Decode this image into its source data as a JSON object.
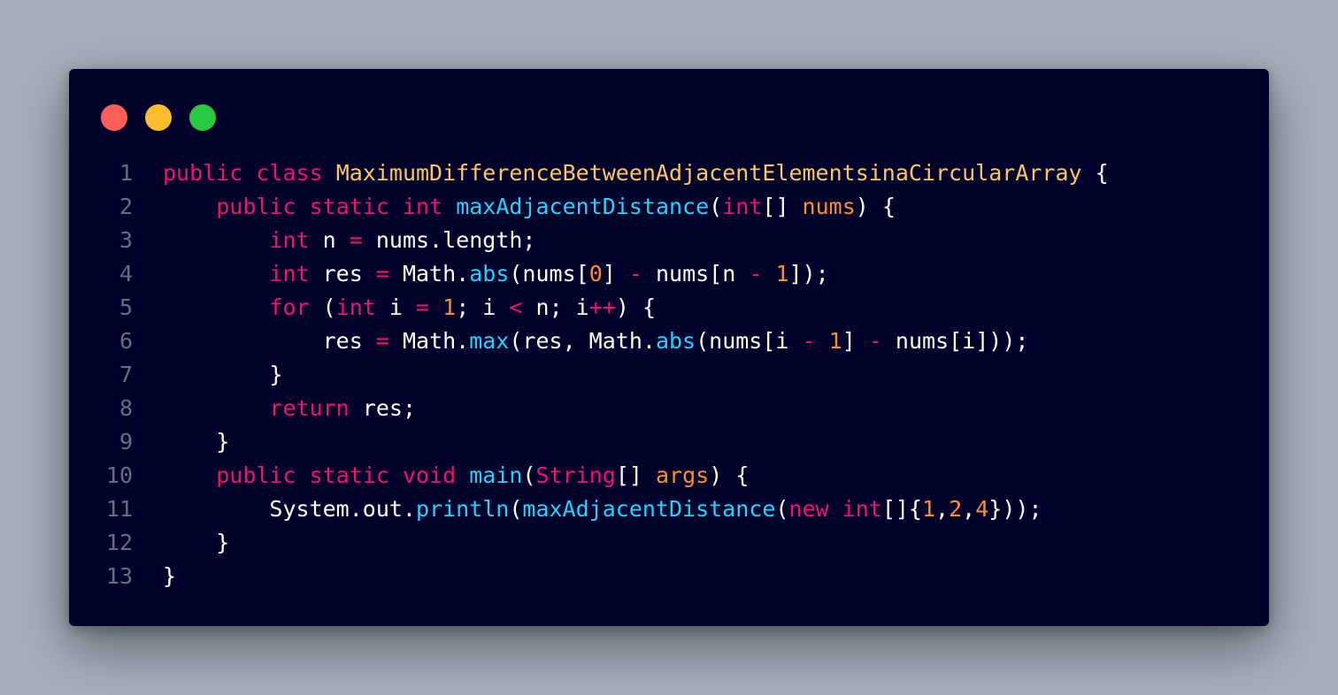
{
  "window": {
    "controls": [
      {
        "name": "close",
        "color": "#ff5f57"
      },
      {
        "name": "minimize",
        "color": "#febc2e"
      },
      {
        "name": "zoom",
        "color": "#28c840"
      }
    ]
  },
  "colors": {
    "kw": "#f0126b",
    "cls": "#ffc563",
    "fn": "#21d4fd",
    "num": "#ff8c2e",
    "prm": "#ff8c2e",
    "op": "#f0126b",
    "txt": "#ffffff"
  },
  "code_lines": [
    {
      "number": "1",
      "tokens": [
        {
          "t": "kw",
          "v": "public"
        },
        {
          "t": "txt",
          "v": " "
        },
        {
          "t": "kw",
          "v": "class"
        },
        {
          "t": "txt",
          "v": " "
        },
        {
          "t": "cls",
          "v": "MaximumDifferenceBetweenAdjacentElementsinaCircularArray"
        },
        {
          "t": "txt",
          "v": " {"
        }
      ]
    },
    {
      "number": "2",
      "tokens": [
        {
          "t": "txt",
          "v": "    "
        },
        {
          "t": "kw",
          "v": "public"
        },
        {
          "t": "txt",
          "v": " "
        },
        {
          "t": "kw",
          "v": "static"
        },
        {
          "t": "txt",
          "v": " "
        },
        {
          "t": "kw",
          "v": "int"
        },
        {
          "t": "txt",
          "v": " "
        },
        {
          "t": "fn",
          "v": "maxAdjacentDistance"
        },
        {
          "t": "txt",
          "v": "("
        },
        {
          "t": "kw",
          "v": "int"
        },
        {
          "t": "txt",
          "v": "[] "
        },
        {
          "t": "prm",
          "v": "nums"
        },
        {
          "t": "txt",
          "v": ") {"
        }
      ]
    },
    {
      "number": "3",
      "tokens": [
        {
          "t": "txt",
          "v": "        "
        },
        {
          "t": "kw",
          "v": "int"
        },
        {
          "t": "txt",
          "v": " n "
        },
        {
          "t": "op",
          "v": "="
        },
        {
          "t": "txt",
          "v": " nums.length;"
        }
      ]
    },
    {
      "number": "4",
      "tokens": [
        {
          "t": "txt",
          "v": "        "
        },
        {
          "t": "kw",
          "v": "int"
        },
        {
          "t": "txt",
          "v": " res "
        },
        {
          "t": "op",
          "v": "="
        },
        {
          "t": "txt",
          "v": " Math."
        },
        {
          "t": "fn",
          "v": "abs"
        },
        {
          "t": "txt",
          "v": "(nums["
        },
        {
          "t": "num",
          "v": "0"
        },
        {
          "t": "txt",
          "v": "] "
        },
        {
          "t": "op",
          "v": "-"
        },
        {
          "t": "txt",
          "v": " nums[n "
        },
        {
          "t": "op",
          "v": "-"
        },
        {
          "t": "txt",
          "v": " "
        },
        {
          "t": "num",
          "v": "1"
        },
        {
          "t": "txt",
          "v": "]);"
        }
      ]
    },
    {
      "number": "5",
      "tokens": [
        {
          "t": "txt",
          "v": "        "
        },
        {
          "t": "kw",
          "v": "for"
        },
        {
          "t": "txt",
          "v": " ("
        },
        {
          "t": "kw",
          "v": "int"
        },
        {
          "t": "txt",
          "v": " i "
        },
        {
          "t": "op",
          "v": "="
        },
        {
          "t": "txt",
          "v": " "
        },
        {
          "t": "num",
          "v": "1"
        },
        {
          "t": "txt",
          "v": "; i "
        },
        {
          "t": "op",
          "v": "<"
        },
        {
          "t": "txt",
          "v": " n; i"
        },
        {
          "t": "op",
          "v": "++"
        },
        {
          "t": "txt",
          "v": ") {"
        }
      ]
    },
    {
      "number": "6",
      "tokens": [
        {
          "t": "txt",
          "v": "            res "
        },
        {
          "t": "op",
          "v": "="
        },
        {
          "t": "txt",
          "v": " Math."
        },
        {
          "t": "fn",
          "v": "max"
        },
        {
          "t": "txt",
          "v": "(res, Math."
        },
        {
          "t": "fn",
          "v": "abs"
        },
        {
          "t": "txt",
          "v": "(nums[i "
        },
        {
          "t": "op",
          "v": "-"
        },
        {
          "t": "txt",
          "v": " "
        },
        {
          "t": "num",
          "v": "1"
        },
        {
          "t": "txt",
          "v": "] "
        },
        {
          "t": "op",
          "v": "-"
        },
        {
          "t": "txt",
          "v": " nums[i]));"
        }
      ]
    },
    {
      "number": "7",
      "tokens": [
        {
          "t": "txt",
          "v": "        }"
        }
      ]
    },
    {
      "number": "8",
      "tokens": [
        {
          "t": "txt",
          "v": "        "
        },
        {
          "t": "kw",
          "v": "return"
        },
        {
          "t": "txt",
          "v": " res;"
        }
      ]
    },
    {
      "number": "9",
      "tokens": [
        {
          "t": "txt",
          "v": "    }"
        }
      ]
    },
    {
      "number": "10",
      "tokens": [
        {
          "t": "txt",
          "v": "    "
        },
        {
          "t": "kw",
          "v": "public"
        },
        {
          "t": "txt",
          "v": " "
        },
        {
          "t": "kw",
          "v": "static"
        },
        {
          "t": "txt",
          "v": " "
        },
        {
          "t": "kw",
          "v": "void"
        },
        {
          "t": "txt",
          "v": " "
        },
        {
          "t": "fn",
          "v": "main"
        },
        {
          "t": "txt",
          "v": "("
        },
        {
          "t": "kw",
          "v": "String"
        },
        {
          "t": "txt",
          "v": "[] "
        },
        {
          "t": "prm",
          "v": "args"
        },
        {
          "t": "txt",
          "v": ") {"
        }
      ]
    },
    {
      "number": "11",
      "tokens": [
        {
          "t": "txt",
          "v": "        System.out."
        },
        {
          "t": "fn",
          "v": "println"
        },
        {
          "t": "txt",
          "v": "("
        },
        {
          "t": "fn",
          "v": "maxAdjacentDistance"
        },
        {
          "t": "txt",
          "v": "("
        },
        {
          "t": "kw",
          "v": "new"
        },
        {
          "t": "txt",
          "v": " "
        },
        {
          "t": "kw",
          "v": "int"
        },
        {
          "t": "txt",
          "v": "[]{"
        },
        {
          "t": "num",
          "v": "1"
        },
        {
          "t": "txt",
          "v": ","
        },
        {
          "t": "num",
          "v": "2"
        },
        {
          "t": "txt",
          "v": ","
        },
        {
          "t": "num",
          "v": "4"
        },
        {
          "t": "txt",
          "v": "}));"
        }
      ]
    },
    {
      "number": "12",
      "tokens": [
        {
          "t": "txt",
          "v": "    }"
        }
      ]
    },
    {
      "number": "13",
      "tokens": [
        {
          "t": "txt",
          "v": "}"
        }
      ]
    }
  ]
}
